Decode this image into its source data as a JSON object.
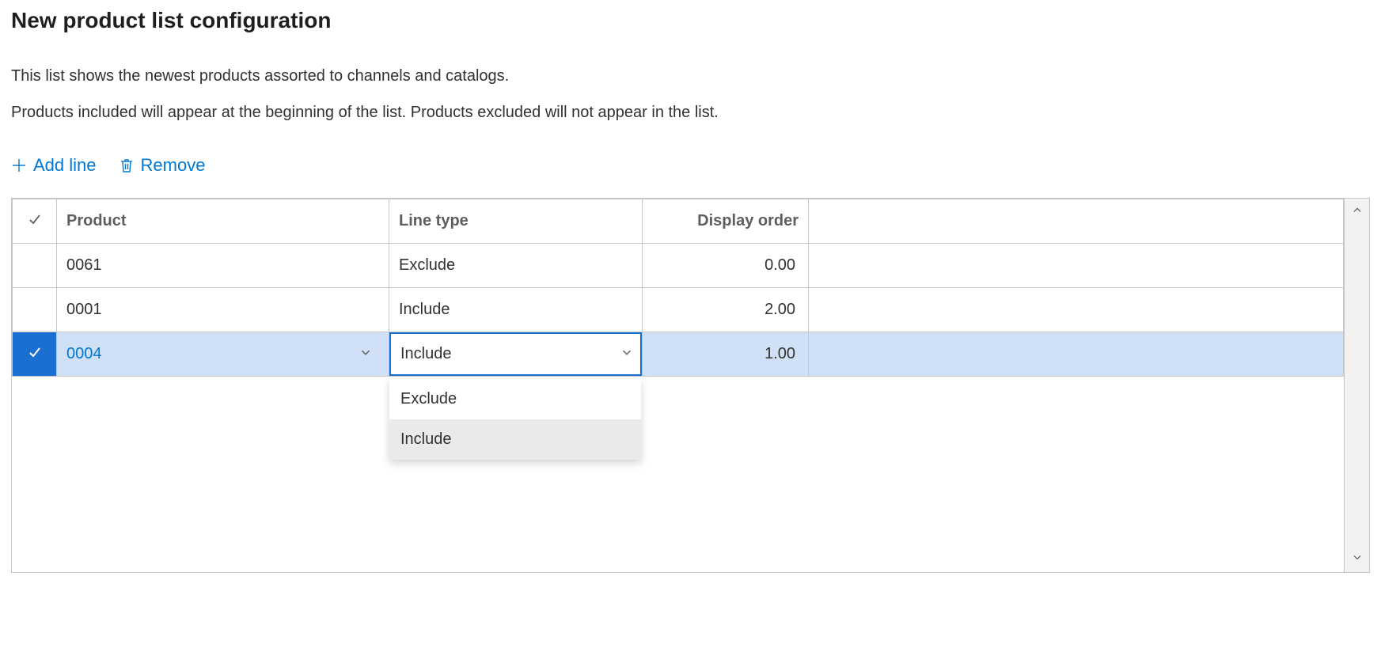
{
  "title": "New product list configuration",
  "description_line1": "This list shows the newest products assorted to channels and catalogs.",
  "description_line2": "Products included will appear at the beginning of the list. Products excluded will not appear in the list.",
  "toolbar": {
    "add_line": "Add line",
    "remove": "Remove"
  },
  "columns": {
    "product": "Product",
    "line_type": "Line type",
    "display_order": "Display order"
  },
  "rows": [
    {
      "product": "0061",
      "line_type": "Exclude",
      "display_order": "0.00",
      "selected": false
    },
    {
      "product": "0001",
      "line_type": "Include",
      "display_order": "2.00",
      "selected": false
    },
    {
      "product": "0004",
      "line_type": "Include",
      "display_order": "1.00",
      "selected": true
    }
  ],
  "dropdown": {
    "options": [
      {
        "label": "Exclude",
        "hover": false
      },
      {
        "label": "Include",
        "hover": true
      }
    ]
  }
}
